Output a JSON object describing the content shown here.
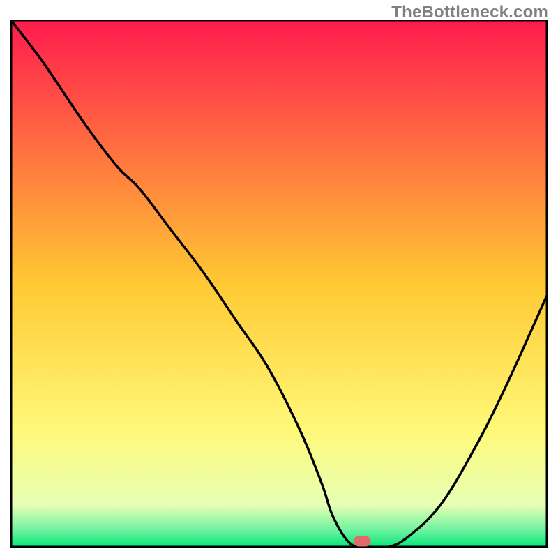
{
  "watermark": "TheBottleneck.com",
  "chart_data": {
    "type": "line",
    "title": "",
    "xlabel": "",
    "ylabel": "",
    "xlim": [
      0,
      100
    ],
    "ylim": [
      0,
      100
    ],
    "grid": false,
    "legend": false,
    "background_gradient": {
      "stops": [
        {
          "offset": 0.0,
          "color": "#ff1a4d"
        },
        {
          "offset": 0.5,
          "color": "#ffc933"
        },
        {
          "offset": 0.78,
          "color": "#fff97a"
        },
        {
          "offset": 0.92,
          "color": "#e6ffb5"
        },
        {
          "offset": 0.97,
          "color": "#66f29d"
        },
        {
          "offset": 1.0,
          "color": "#00e676"
        }
      ]
    },
    "series": [
      {
        "name": "bottleneck-curve",
        "x": [
          0,
          6,
          14,
          20,
          24,
          30,
          36,
          42,
          48,
          54,
          58,
          60,
          63,
          66,
          70,
          74,
          80,
          86,
          92,
          100
        ],
        "y": [
          100,
          92,
          80,
          72,
          68,
          60,
          52,
          43,
          34,
          22,
          12,
          6,
          1,
          0,
          0,
          2,
          8,
          18,
          30,
          48
        ]
      }
    ],
    "marker": {
      "name": "optimal-point",
      "x": 65.5,
      "y": 1.2,
      "color": "#e46a6a",
      "width": 3.2,
      "height": 2.0
    }
  }
}
